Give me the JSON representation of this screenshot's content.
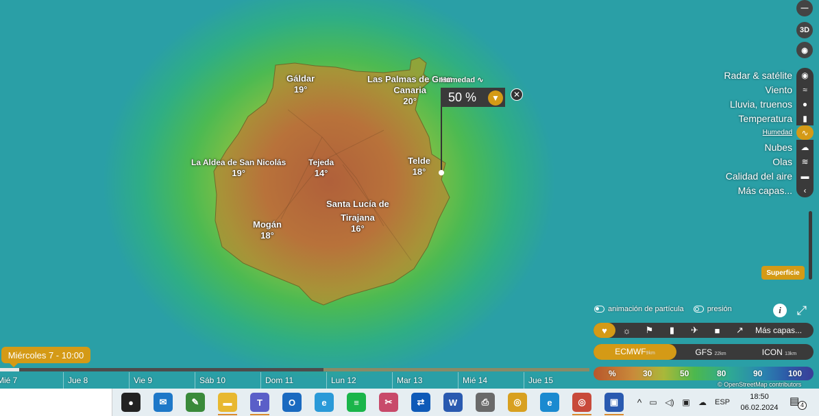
{
  "map": {
    "cities": [
      {
        "name": "Gáldar",
        "temp": "19°"
      },
      {
        "name": "Las Palmas de Gran\nCanaria",
        "temp": "20°"
      },
      {
        "name": "La Aldea de San Nicolás",
        "temp": "19°"
      },
      {
        "name": "Tejeda",
        "temp": "14°"
      },
      {
        "name": "Telde",
        "temp": "18°"
      },
      {
        "name": "Santa Lucía de\nTirajana",
        "temp": "16°"
      },
      {
        "name": "Mogán",
        "temp": "18°"
      }
    ],
    "popup": {
      "layer": "Humedad",
      "value": "50 %"
    }
  },
  "controls": {
    "threed": "3D"
  },
  "layers": [
    {
      "label": "Radar & satélite",
      "icon": "radar-icon",
      "glyph": "◉"
    },
    {
      "label": "Viento",
      "icon": "wind-icon",
      "glyph": "≈"
    },
    {
      "label": "Lluvia, truenos",
      "icon": "rain-icon",
      "glyph": "●"
    },
    {
      "label": "Temperatura",
      "icon": "thermometer-icon",
      "glyph": "▮"
    },
    {
      "label": "Humedad",
      "icon": "humidity-icon",
      "glyph": "∿",
      "selected": true
    },
    {
      "label": "Nubes",
      "icon": "cloud-icon",
      "glyph": "☁"
    },
    {
      "label": "Olas",
      "icon": "waves-icon",
      "glyph": "≋"
    },
    {
      "label": "Calidad del aire",
      "icon": "car-icon",
      "glyph": "▬"
    },
    {
      "label": "Más capas...",
      "icon": "chevron-left-icon",
      "glyph": "‹"
    }
  ],
  "surface_button": "Superficie",
  "toggles": {
    "particles": "animación de partícula",
    "pressure": "presión"
  },
  "favbar": {
    "more": "Más capas..."
  },
  "models": [
    {
      "name": "ECMWF",
      "res": "9km",
      "selected": true
    },
    {
      "name": "GFS",
      "res": "22km"
    },
    {
      "name": "ICON",
      "res": "13km"
    }
  ],
  "legend": {
    "unit": "%",
    "ticks": [
      "30",
      "50",
      "80",
      "90",
      "100"
    ],
    "attribution": "© OpenStreetMap contributors"
  },
  "timeline": {
    "current": "Miércoles 7 - 10:00",
    "days": [
      "Mié 7",
      "Jue 8",
      "Vie 9",
      "Sáb 10",
      "Dom 11",
      "Lun 12",
      "Mar 13",
      "Mié 14",
      "Jue 15"
    ]
  },
  "taskbar": {
    "apps": [
      {
        "name": "obs-icon",
        "color": "#222",
        "glyph": "●"
      },
      {
        "name": "mail-icon",
        "color": "#1e78c8",
        "glyph": "✉"
      },
      {
        "name": "notepad-icon",
        "color": "#3a8a3a",
        "glyph": "✎"
      },
      {
        "name": "file-explorer-icon",
        "color": "#e8b830",
        "glyph": "▬",
        "active": true
      },
      {
        "name": "teams-icon",
        "color": "#5a5fc8",
        "glyph": "T",
        "active": true
      },
      {
        "name": "outlook-icon",
        "color": "#1a6ac0",
        "glyph": "O"
      },
      {
        "name": "internet-explorer-icon",
        "color": "#2a9ad8",
        "glyph": "e"
      },
      {
        "name": "spotify-icon",
        "color": "#1ab54a",
        "glyph": "≡"
      },
      {
        "name": "snipping-tool-icon",
        "color": "#c84a6a",
        "glyph": "✂"
      },
      {
        "name": "teamviewer-icon",
        "color": "#0e5ab8",
        "glyph": "⇄"
      },
      {
        "name": "word-icon",
        "color": "#2a5ab0",
        "glyph": "W"
      },
      {
        "name": "printer-icon",
        "color": "#6a6a6a",
        "glyph": "⎙"
      },
      {
        "name": "chrome-icon",
        "color": "#d8a020",
        "glyph": "◎"
      },
      {
        "name": "edge-icon",
        "color": "#1a8ad0",
        "glyph": "e"
      },
      {
        "name": "chrome-profile-icon",
        "color": "#c84a3a",
        "glyph": "◎",
        "active": true
      },
      {
        "name": "remote-desktop-icon",
        "color": "#2a5ab0",
        "glyph": "▣",
        "active": true
      }
    ],
    "language": "ESP",
    "time": "18:50",
    "date": "06.02.2024",
    "notifications": "4"
  }
}
